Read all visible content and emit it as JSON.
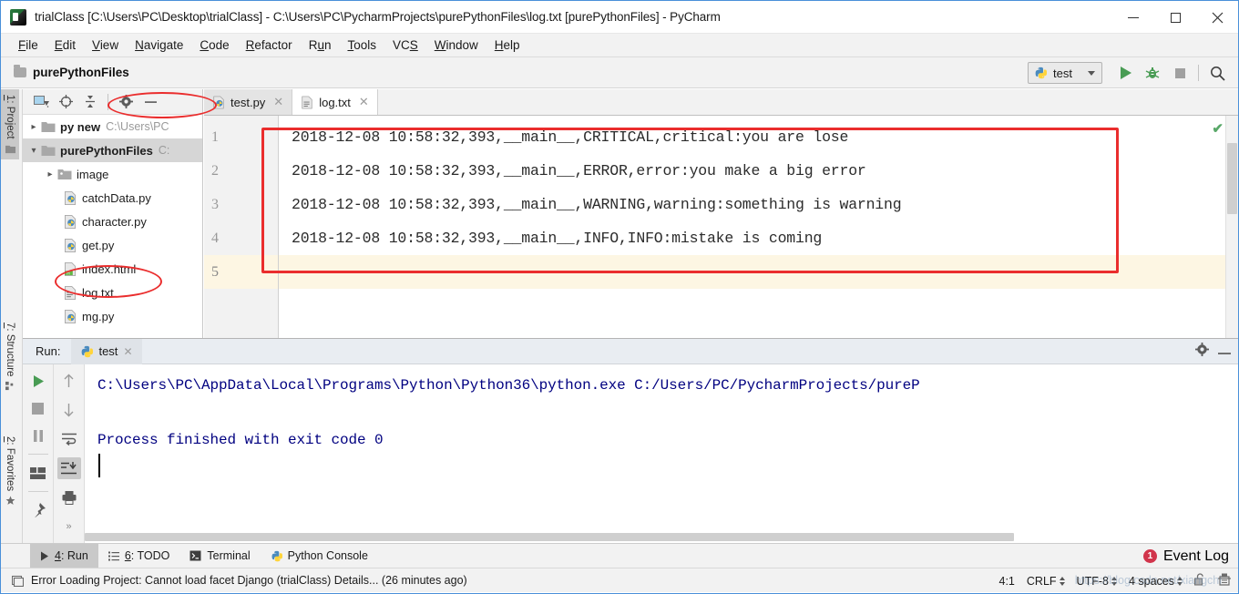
{
  "window": {
    "title": "trialClass [C:\\Users\\PC\\Desktop\\trialClass] - C:\\Users\\PC\\PycharmProjects\\purePythonFiles\\log.txt [purePythonFiles] - PyCharm",
    "minimize_label": "–",
    "maximize_label": "□",
    "close_label": "✕"
  },
  "menu": {
    "items": [
      {
        "label": "File",
        "mnemonic": "F",
        "rest": "ile"
      },
      {
        "label": "Edit",
        "mnemonic": "E",
        "rest": "dit"
      },
      {
        "label": "View",
        "mnemonic": "V",
        "rest": "iew"
      },
      {
        "label": "Navigate",
        "mnemonic": "N",
        "rest": "avigate"
      },
      {
        "label": "Code",
        "mnemonic": "C",
        "rest": "ode"
      },
      {
        "label": "Refactor",
        "mnemonic": "R",
        "rest": "efactor"
      },
      {
        "label": "Run",
        "mnemonic": "R",
        "rest": "un",
        "pre": "R",
        "post": "un"
      },
      {
        "label": "Tools",
        "mnemonic": "T",
        "rest": "ools"
      },
      {
        "label": "VCS",
        "mnemonic": "S",
        "rest": ""
      },
      {
        "label": "Window",
        "mnemonic": "W",
        "rest": "indow"
      },
      {
        "label": "Help",
        "mnemonic": "H",
        "rest": "elp"
      }
    ]
  },
  "navbar": {
    "breadcrumb": "purePythonFiles",
    "run_config": "test",
    "icons": [
      "run-icon",
      "debug-icon",
      "stop-icon",
      "search-everywhere-icon"
    ]
  },
  "tool_tabs_left": [
    {
      "label": "1: Project",
      "num": "1",
      "rest": ": Project",
      "icon": "folder-icon",
      "active": true
    },
    {
      "label": "7: Structure",
      "num": "7",
      "rest": ": Structure",
      "icon": "structure-icon",
      "active": false
    },
    {
      "label": "2: Favorites",
      "num": "2",
      "rest": ": Favorites",
      "icon": "star-icon",
      "active": false
    }
  ],
  "project_tree": {
    "toolbar_icons": [
      "select-opened-file-icon",
      "locate-icon",
      "collapse-all-icon",
      "settings-gear-icon",
      "hide-icon"
    ],
    "nodes": [
      {
        "label": "py new",
        "path": "C:\\Users\\PC",
        "icon": "folder-icon",
        "arrow": "›",
        "indent": 0,
        "bold": true,
        "selected": false
      },
      {
        "label": "purePythonFiles",
        "path": "C:",
        "icon": "folder-icon",
        "arrow": "⌄",
        "indent": 0,
        "bold": true,
        "selected": true
      },
      {
        "label": "image",
        "path": "",
        "icon": "folder-icon",
        "arrow": "›",
        "indent": 1,
        "bold": false,
        "selected": false
      },
      {
        "label": "catchData.py",
        "path": "",
        "icon": "python-file-icon",
        "arrow": "",
        "indent": 2,
        "bold": false,
        "selected": false
      },
      {
        "label": "character.py",
        "path": "",
        "icon": "python-file-icon",
        "arrow": "",
        "indent": 2,
        "bold": false,
        "selected": false
      },
      {
        "label": "get.py",
        "path": "",
        "icon": "python-file-icon",
        "arrow": "",
        "indent": 2,
        "bold": false,
        "selected": false
      },
      {
        "label": "index.html",
        "path": "",
        "icon": "html-file-icon",
        "arrow": "",
        "indent": 2,
        "bold": false,
        "selected": false
      },
      {
        "label": "log.txt",
        "path": "",
        "icon": "text-file-icon",
        "arrow": "",
        "indent": 2,
        "bold": false,
        "selected": false
      },
      {
        "label": "mg.py",
        "path": "",
        "icon": "python-file-icon",
        "arrow": "",
        "indent": 2,
        "bold": false,
        "selected": false
      }
    ]
  },
  "editor": {
    "tabs": [
      {
        "label": "test.py",
        "icon": "python-file-icon",
        "active": false,
        "close": "✕"
      },
      {
        "label": "log.txt",
        "icon": "text-file-icon",
        "active": true,
        "close": "✕"
      }
    ],
    "line_numbers": [
      "1",
      "2",
      "3",
      "4",
      "5"
    ],
    "lines": [
      "2018-12-08 10:58:32,393,__main__,CRITICAL,critical:you are lose",
      "2018-12-08 10:58:32,393,__main__,ERROR,error:you make a big error",
      "2018-12-08 10:58:32,393,__main__,WARNING,warning:something is warning",
      "2018-12-08 10:58:32,393,__main__,INFO,INFO:mistake is coming",
      ""
    ],
    "inspection_status": "✔"
  },
  "run_window": {
    "title": "Run:",
    "tab_label": "test",
    "tab_close": "✕",
    "header_icons": [
      "settings-gear-icon",
      "hide-icon"
    ],
    "toolbar_icons": [
      "rerun-icon",
      "stop-icon",
      "pause-icon",
      "layout-icon",
      "pin-icon"
    ],
    "toolbar2_icons": [
      "up-arrow-icon",
      "down-arrow-icon",
      "soft-wrap-icon",
      "scroll-to-end-icon",
      "print-icon",
      "expand-icon"
    ],
    "console_lines": [
      "C:\\Users\\PC\\AppData\\Local\\Programs\\Python\\Python36\\python.exe C:/Users/PC/PycharmProjects/pureP",
      "",
      "Process finished with exit code 0"
    ]
  },
  "tool_window_bar": {
    "items": [
      {
        "label": "4: Run",
        "num": "4",
        "rest": ": Run",
        "icon": "run-icon",
        "active": true
      },
      {
        "label": "6: TODO",
        "num": "6",
        "rest": ": TODO",
        "icon": "todo-icon",
        "active": false
      },
      {
        "label": "Terminal",
        "num": "",
        "rest": "Terminal",
        "icon": "terminal-icon",
        "active": false
      },
      {
        "label": "Python Console",
        "num": "",
        "rest": "Python Console",
        "icon": "python-icon",
        "active": false
      }
    ],
    "event_log": "Event Log",
    "event_badge": "1"
  },
  "status_bar": {
    "message": "Error Loading Project: Cannot load facet Django (trialClass) Details... (26 minutes ago)",
    "caret": "4:1",
    "line_sep": "CRLF",
    "encoding": "UTF-8",
    "indent": "4 spaces",
    "lock_icon": "unlocked-icon",
    "inspection_icon": "inspection-icon"
  },
  "watermark": "https://blog.csdn.net/xiangchi",
  "colors": {
    "accent_blue": "#4a90d9",
    "annotation_red": "#ea2d2d",
    "console_text": "#000080",
    "run_green": "#59a869",
    "current_line": "#fdf6e3"
  }
}
